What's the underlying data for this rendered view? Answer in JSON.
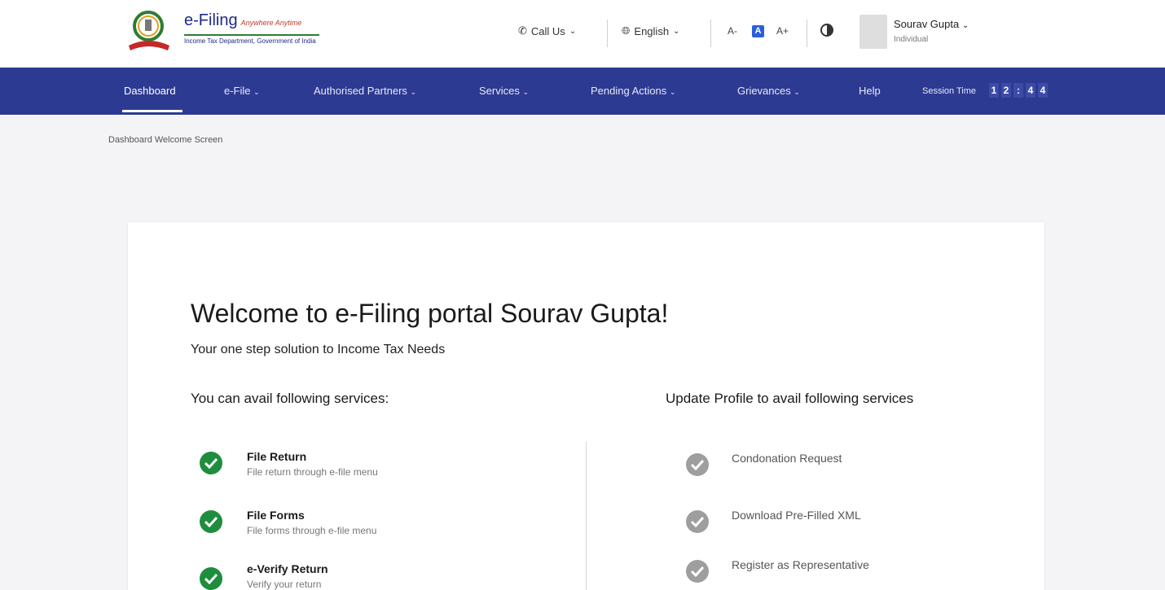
{
  "brand": {
    "title": "e-Filing",
    "tagline": "Anywhere Anytime",
    "subtitle": "Income Tax Department, Government of India"
  },
  "header": {
    "call_us": "Call Us",
    "language": "English",
    "font_decrease": "A-",
    "font_default": "A",
    "font_increase": "A+",
    "user": {
      "name": "Sourav Gupta",
      "role": "Individual"
    }
  },
  "nav": {
    "items": [
      {
        "label": "Dashboard"
      },
      {
        "label": "e-File"
      },
      {
        "label": "Authorised Partners"
      },
      {
        "label": "Services"
      },
      {
        "label": "Pending Actions"
      },
      {
        "label": "Grievances"
      },
      {
        "label": "Help"
      }
    ],
    "session_label": "Session Time",
    "session_digits": [
      "1",
      "2",
      ":",
      "4",
      "4"
    ]
  },
  "breadcrumb": "Dashboard Welcome Screen",
  "main": {
    "welcome": "Welcome to e-Filing portal Sourav Gupta!",
    "tagline": "Your one step solution to Income Tax Needs",
    "left_heading": "You can avail following services:",
    "right_heading": "Update Profile to avail following services",
    "available_services": [
      {
        "title": "File Return",
        "desc": "File return through e-file menu"
      },
      {
        "title": "File Forms",
        "desc": "File forms through e-file menu"
      },
      {
        "title": "e-Verify Return",
        "desc": "Verify your return"
      }
    ],
    "update_services": [
      {
        "title": "Condonation Request"
      },
      {
        "title": "Download Pre-Filled XML"
      },
      {
        "title": "Register as Representative"
      }
    ]
  },
  "colors": {
    "nav_bg": "#2d3a92",
    "check_available": "#1e8e3e",
    "check_locked": "#9e9e9e"
  }
}
